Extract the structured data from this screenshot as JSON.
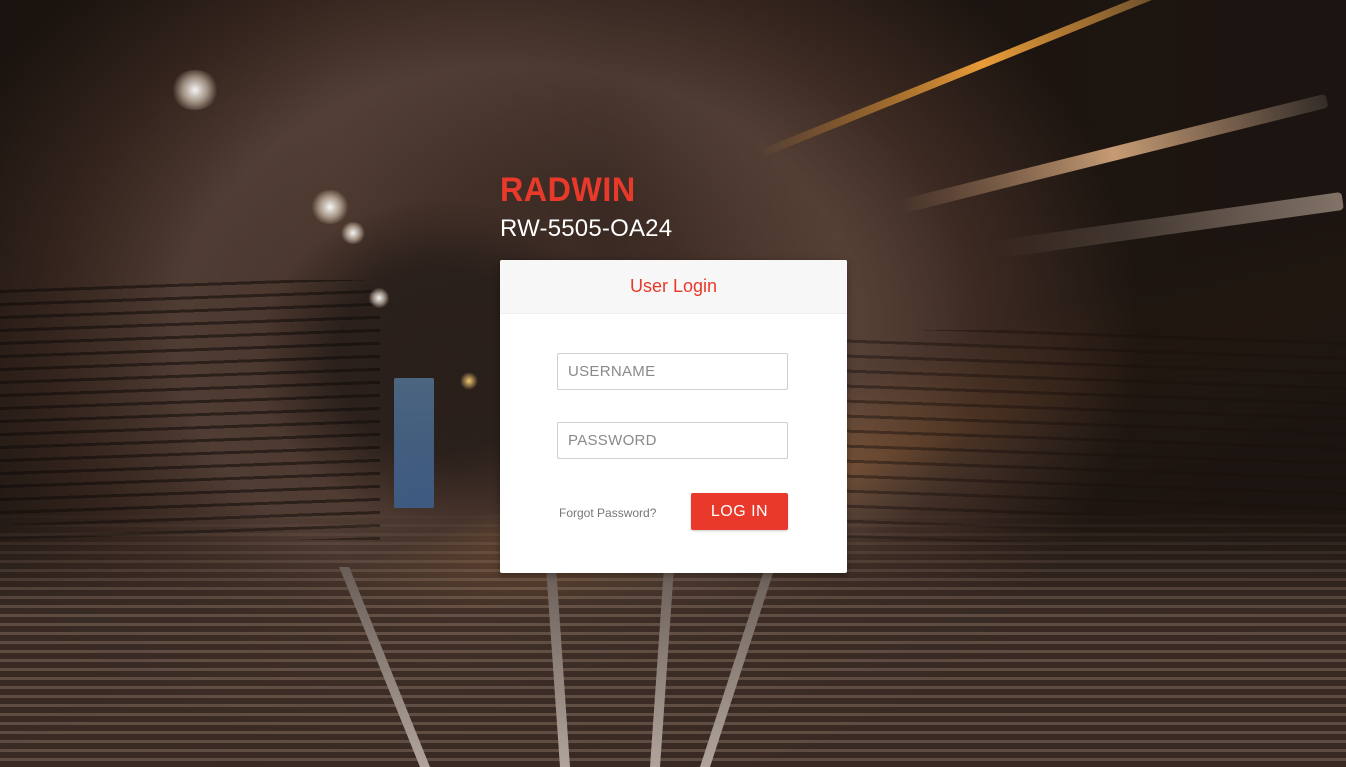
{
  "brand": {
    "logo_text": "RADWIN",
    "accent_color": "#e8392a"
  },
  "device": {
    "model": "RW-5505-OA24"
  },
  "login": {
    "title": "User Login",
    "username_placeholder": "USERNAME",
    "password_placeholder": "PASSWORD",
    "username_value": "",
    "password_value": "",
    "forgot_label": "Forgot Password?",
    "submit_label": "LOG IN"
  },
  "background": {
    "description_icon": "subway-tunnel-background"
  }
}
